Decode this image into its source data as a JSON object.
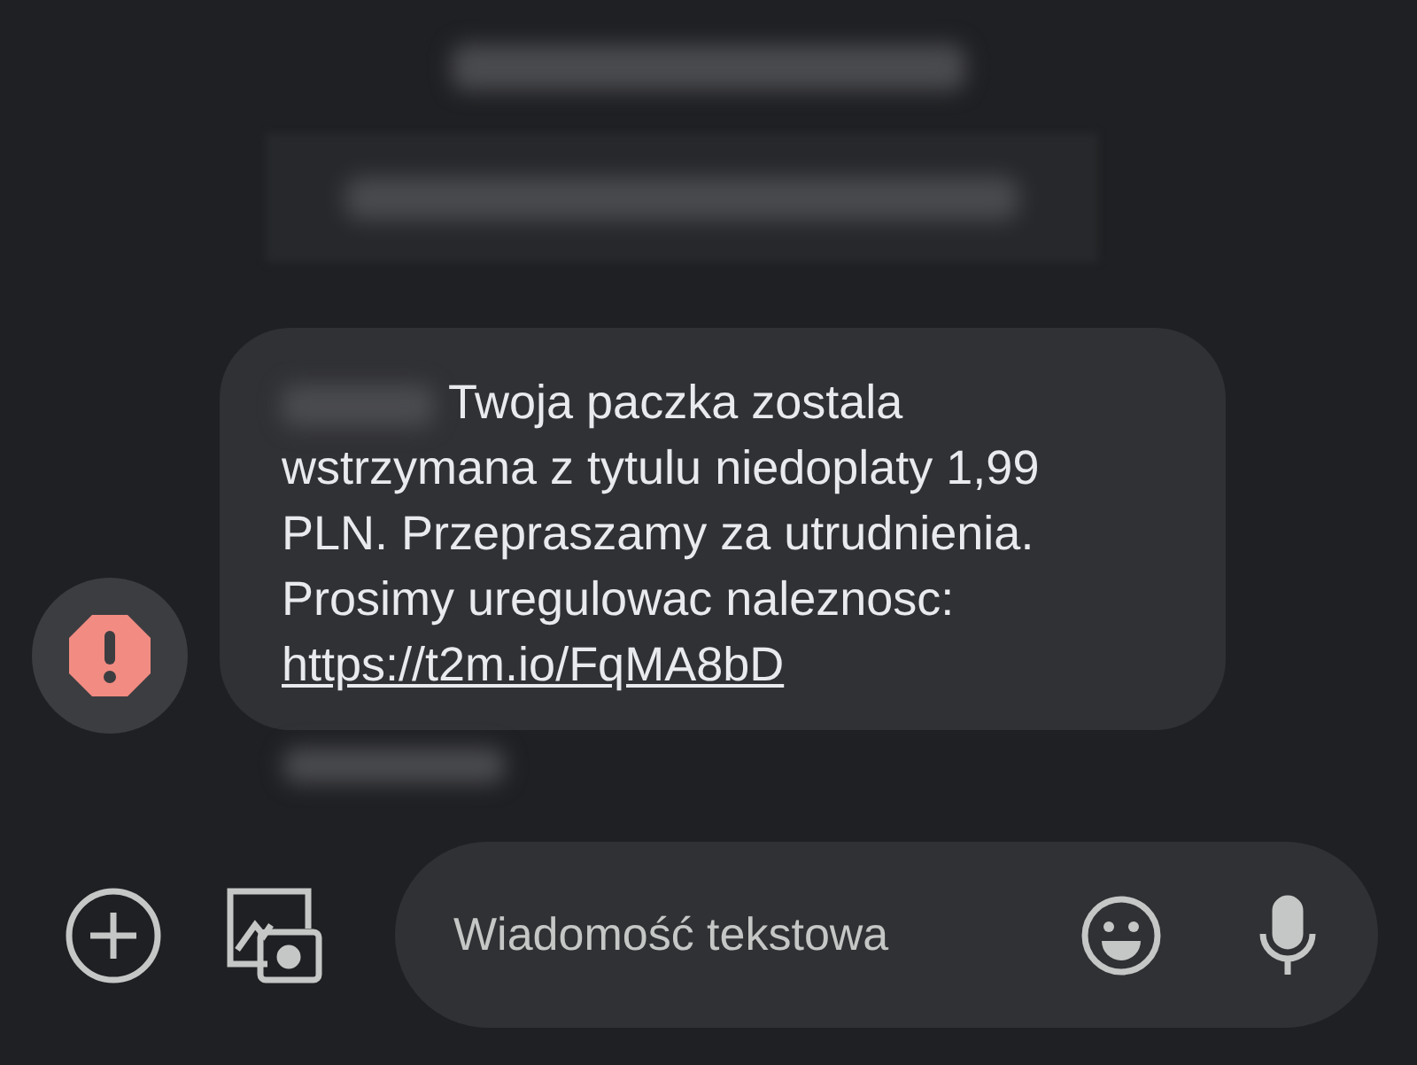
{
  "message": {
    "text": "Twoja paczka zostala wstrzymana z tytulu niedoplaty 1,99 PLN. Przepraszamy za utrudnienia. Prosimy uregulowac naleznosc:",
    "link": "https://t2m.io/FqMA8bD",
    "failed": true
  },
  "composer": {
    "placeholder": "Wiadomość tekstowa"
  }
}
